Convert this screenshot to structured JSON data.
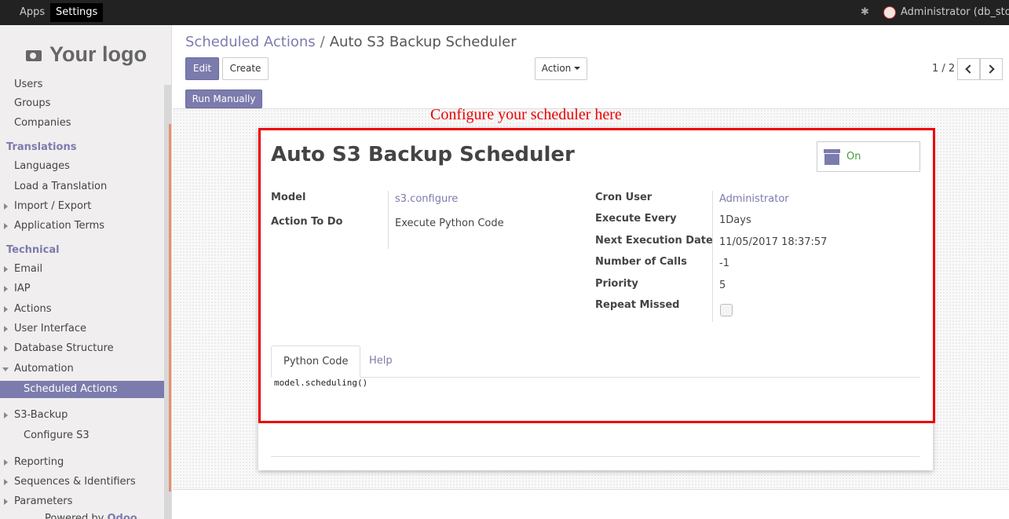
{
  "topbar": {
    "apps": "Apps",
    "settings": "Settings",
    "user": "Administrator (db_store)"
  },
  "sidebar": {
    "logo": "Your logo",
    "items": [
      {
        "label": "Users"
      },
      {
        "label": "Groups"
      },
      {
        "label": "Companies"
      },
      {
        "label": "Translations"
      },
      {
        "label": "Languages"
      },
      {
        "label": "Load a Translation"
      },
      {
        "label": "Import / Export"
      },
      {
        "label": "Application Terms"
      },
      {
        "label": "Technical"
      },
      {
        "label": "Email"
      },
      {
        "label": "IAP"
      },
      {
        "label": "Actions"
      },
      {
        "label": "User Interface"
      },
      {
        "label": "Database Structure"
      },
      {
        "label": "Automation"
      },
      {
        "label": "Scheduled Actions"
      },
      {
        "label": "S3-Backup"
      },
      {
        "label": "Configure S3"
      },
      {
        "label": "Reporting"
      },
      {
        "label": "Sequences & Identifiers"
      },
      {
        "label": "Parameters"
      }
    ],
    "powered_prefix": "Powered by",
    "powered_brand": "Odoo"
  },
  "breadcrumb": {
    "parent": "Scheduled Actions",
    "separator": "/",
    "current": "Auto S3 Backup Scheduler"
  },
  "toolbar": {
    "edit": "Edit",
    "create": "Create",
    "action": "Action",
    "pager": "1 / 2",
    "run_manually": "Run Manually"
  },
  "annotation": "Configure your scheduler here",
  "form": {
    "title": "Auto S3 Backup Scheduler",
    "active_label": "On",
    "left_fields": [
      {
        "label": "Model",
        "value": "s3.configure"
      },
      {
        "label": "Action To Do",
        "value": "Execute Python Code"
      }
    ],
    "right_fields": [
      {
        "label": "Cron User",
        "value": "Administrator"
      },
      {
        "label": "Execute Every",
        "value": "1Days"
      },
      {
        "label": "Next Execution Date",
        "value": "11/05/2017 18:37:57"
      },
      {
        "label": "Number of Calls",
        "value": "-1"
      },
      {
        "label": "Priority",
        "value": "5"
      },
      {
        "label": "Repeat Missed",
        "value": false
      }
    ],
    "tabs": [
      {
        "label": "Python Code"
      },
      {
        "label": "Help"
      }
    ],
    "code": "model.scheduling()"
  },
  "colors": {
    "accent": "#7c7bad",
    "annotation": "#ee0000",
    "topbar": "#222222"
  }
}
